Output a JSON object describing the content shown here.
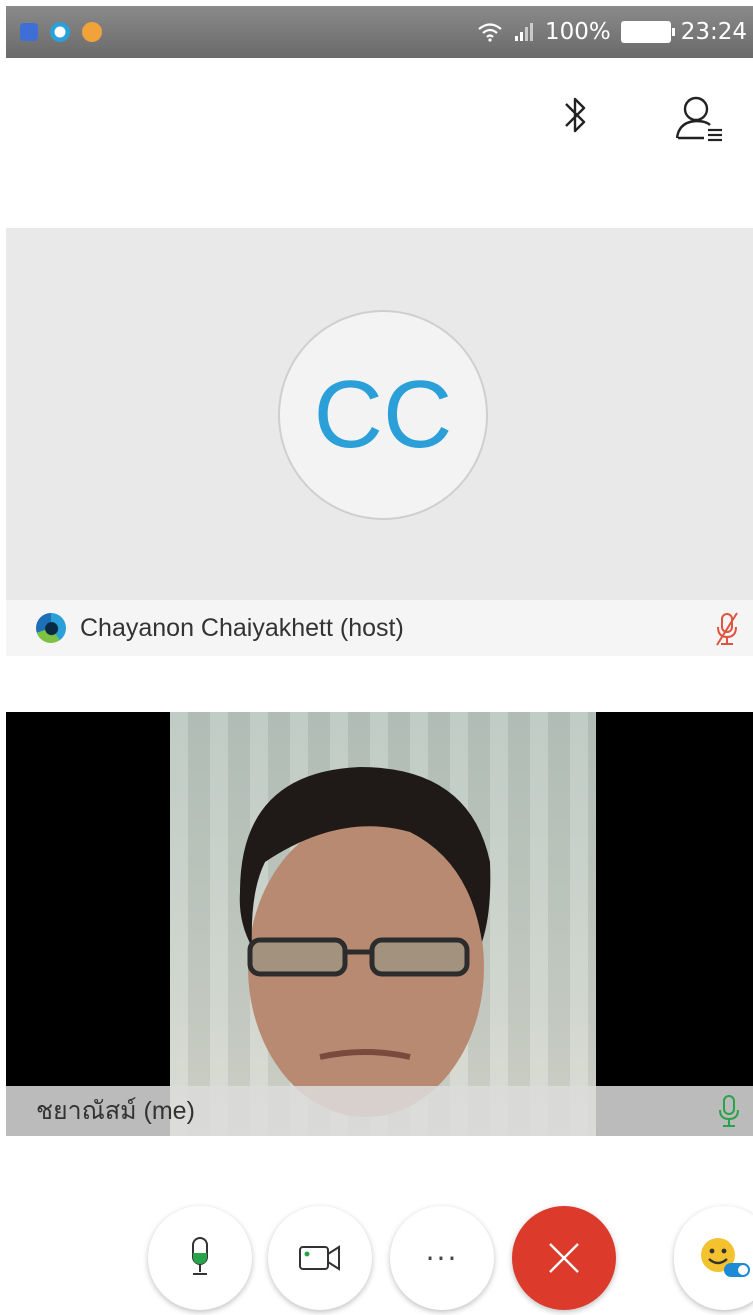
{
  "status_bar": {
    "battery": "100%",
    "time": "23:24"
  },
  "top_bar": {
    "icons": [
      "bluetooth-icon",
      "participants-icon"
    ]
  },
  "host": {
    "initials": "CC",
    "name": "Chayanon Chaiyakhett (host)",
    "muted": true
  },
  "self": {
    "name": "ชยาณัสม์ (me)",
    "mic_on": true
  },
  "controls": {
    "more_label": "···"
  },
  "colors": {
    "accent": "#2a9fd8",
    "end_call": "#dc3b2c",
    "mic_on": "#29a34a",
    "muted": "#e0533f"
  }
}
